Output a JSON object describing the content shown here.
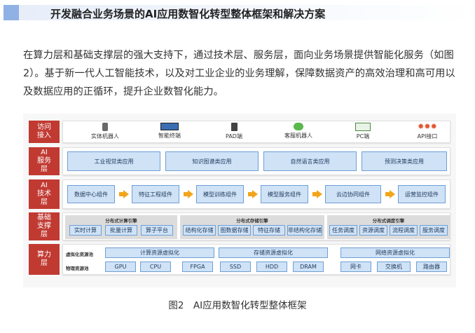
{
  "heading": "开发融合业务场景的AI应用数智化转型整体框架和解决方案",
  "paragraph": "在算力层和基础支撑层的强大支持下，通过技术层、服务层，面向业务场景提供智能化服务（如图2）。基于新一代人工智能技术，以及对工业企业的业务理解，保障数据资产的高效治理和高可用以及数据应用的正循环，提升企业数智化能力。",
  "figure": {
    "access": {
      "label": "访问\n接入",
      "items": [
        {
          "label": "实体机器人",
          "icon": "robot-icon"
        },
        {
          "label": "智能终端",
          "icon": "tablet-icon"
        },
        {
          "label": "PAD端",
          "icon": "pad-icon"
        },
        {
          "label": "客服机器人",
          "icon": "chat-icon"
        },
        {
          "label": "PC端",
          "icon": "monitor-icon"
        },
        {
          "label": "API接口",
          "icon": "api-icon"
        }
      ]
    },
    "service": {
      "label": "AI\n服务\n层",
      "items": [
        "工业视觉类应用",
        "知识图谱类应用",
        "自然语言类应用",
        "预测决策类应用"
      ]
    },
    "tech": {
      "label": "AI\n技术\n层",
      "items": [
        "数据中心组件",
        "特征工程组件",
        "模型训练组件",
        "模型服务组件",
        "云边协同组件",
        "运营监控组件"
      ]
    },
    "base": {
      "label": "基础\n支撑\n层",
      "groups": [
        {
          "title": "分布式计算引擎",
          "items": [
            "实时计算",
            "批量计算",
            "算子平台"
          ]
        },
        {
          "title": "分布式存储引擎",
          "items": [
            "结构化存储",
            "图数据存储",
            "特征存储",
            "非结构化存储"
          ]
        },
        {
          "title": "分布式调度引擎",
          "items": [
            "任务调度",
            "资源调度",
            "流程调度",
            "服务调度"
          ]
        }
      ]
    },
    "compute": {
      "label": "算力\n层",
      "virtual_label": "虚拟化资源池",
      "virtual_items": [
        "计算资源虚拟化",
        "存储资源虚拟化",
        "网络资源虚拟化"
      ],
      "physical_label": "物理资源池",
      "physical_items": [
        "GPU",
        "CPU",
        "FPGA",
        "SSD",
        "HDD",
        "DRAM",
        "网卡",
        "交换机",
        "路由器"
      ]
    }
  },
  "caption": "图2　AI应用数智化转型整体框架",
  "colors": {
    "layer_label": "#c13a32",
    "box_fill": "#cfe2f6",
    "box_border": "#6f9fd6",
    "arrow": "#f2a51c",
    "heading_accent": "#8fb1e3"
  }
}
